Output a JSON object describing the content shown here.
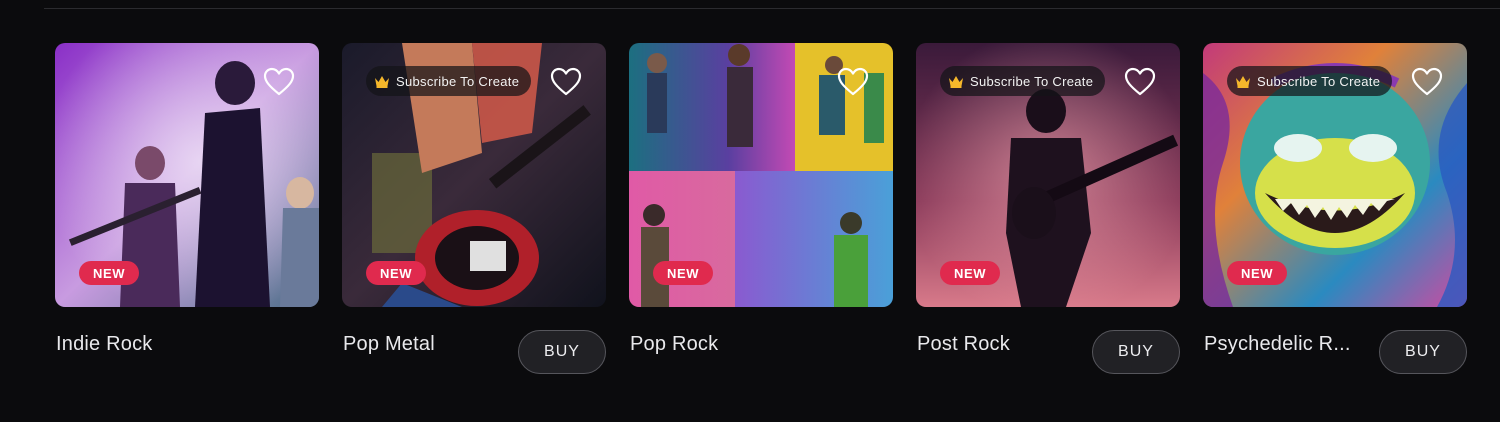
{
  "cards": [
    {
      "title": "Indie Rock",
      "badge": "NEW",
      "subscribe": "",
      "buy": ""
    },
    {
      "title": "Pop Metal",
      "badge": "NEW",
      "subscribe": "Subscribe To Create",
      "buy": "BUY"
    },
    {
      "title": "Pop Rock",
      "badge": "NEW",
      "subscribe": "",
      "buy": ""
    },
    {
      "title": "Post Rock",
      "badge": "NEW",
      "subscribe": "Subscribe To Create",
      "buy": "BUY"
    },
    {
      "title": "Psychedelic R...",
      "badge": "NEW",
      "subscribe": "Subscribe To Create",
      "buy": "BUY"
    }
  ],
  "icons": {
    "favorite": "heart-outline-icon",
    "premium": "crown-icon"
  },
  "colors": {
    "background": "#0b0b0d",
    "new_badge": "#e02a4e",
    "crown": "#f5b72b"
  }
}
